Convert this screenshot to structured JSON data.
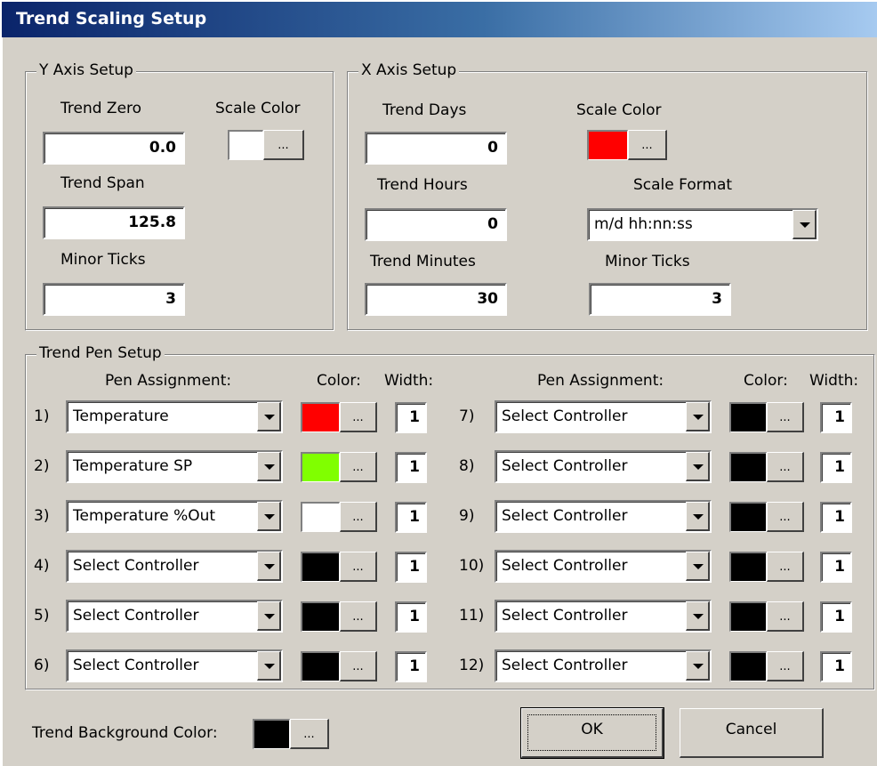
{
  "window": {
    "title": "Trend Scaling Setup"
  },
  "y_axis": {
    "group_label": "Y Axis Setup",
    "trend_zero_label": "Trend Zero",
    "trend_zero": "0.0",
    "scale_color_label": "Scale Color",
    "scale_color": "#ffffff",
    "trend_span_label": "Trend Span",
    "trend_span": "125.8",
    "minor_ticks_label": "Minor Ticks",
    "minor_ticks": "3"
  },
  "x_axis": {
    "group_label": "X Axis Setup",
    "trend_days_label": "Trend Days",
    "trend_days": "0",
    "scale_color_label": "Scale Color",
    "scale_color": "#ff0000",
    "trend_hours_label": "Trend Hours",
    "trend_hours": "0",
    "scale_format_label": "Scale Format",
    "scale_format": "m/d hh:nn:ss",
    "trend_minutes_label": "Trend Minutes",
    "trend_minutes": "30",
    "minor_ticks_label": "Minor Ticks",
    "minor_ticks": "3"
  },
  "pens": {
    "group_label": "Trend Pen Setup",
    "assignment_header": "Pen Assignment:",
    "color_header": "Color:",
    "width_header": "Width:",
    "browse_label": "...",
    "items": [
      {
        "num": "1)",
        "assignment": "Temperature",
        "color": "#ff0000",
        "width": "1"
      },
      {
        "num": "2)",
        "assignment": "Temperature SP",
        "color": "#80ff00",
        "width": "1"
      },
      {
        "num": "3)",
        "assignment": "Temperature %Out",
        "color": "#ffffff",
        "width": "1"
      },
      {
        "num": "4)",
        "assignment": "Select Controller",
        "color": "#000000",
        "width": "1"
      },
      {
        "num": "5)",
        "assignment": "Select Controller",
        "color": "#000000",
        "width": "1"
      },
      {
        "num": "6)",
        "assignment": "Select Controller",
        "color": "#000000",
        "width": "1"
      },
      {
        "num": "7)",
        "assignment": "Select Controller",
        "color": "#000000",
        "width": "1"
      },
      {
        "num": "8)",
        "assignment": "Select Controller",
        "color": "#000000",
        "width": "1"
      },
      {
        "num": "9)",
        "assignment": "Select Controller",
        "color": "#000000",
        "width": "1"
      },
      {
        "num": "10)",
        "assignment": "Select Controller",
        "color": "#000000",
        "width": "1"
      },
      {
        "num": "11)",
        "assignment": "Select Controller",
        "color": "#000000",
        "width": "1"
      },
      {
        "num": "12)",
        "assignment": "Select Controller",
        "color": "#000000",
        "width": "1"
      }
    ]
  },
  "footer": {
    "background_color_label": "Trend Background Color:",
    "background_color": "#000000",
    "ok_label": "OK",
    "cancel_label": "Cancel"
  }
}
